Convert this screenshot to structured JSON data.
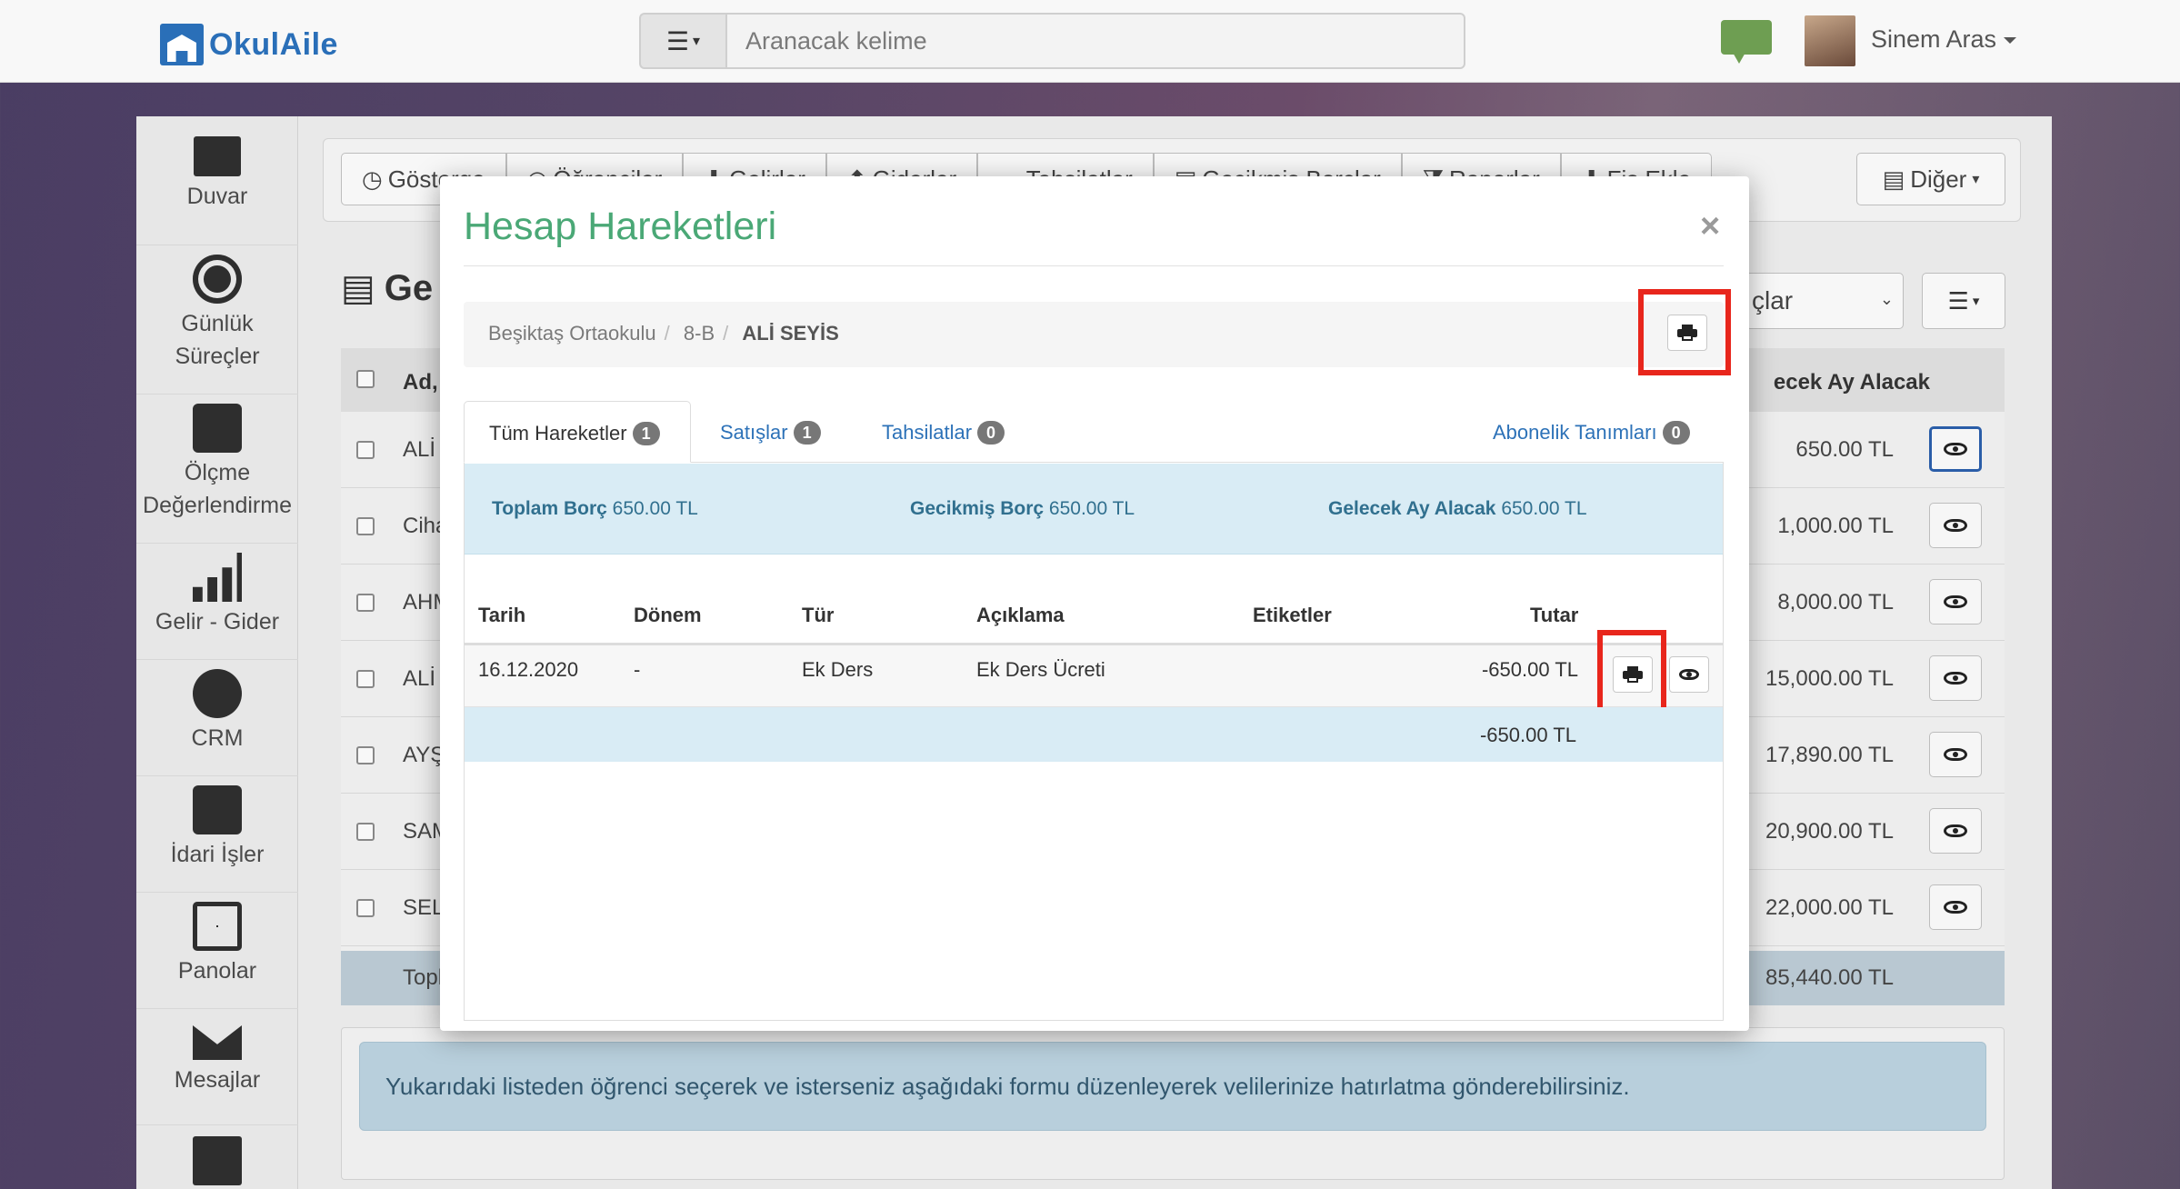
{
  "navbar": {
    "logo_text": "OkulAile",
    "search_placeholder": "Aranacak kelime",
    "user_name": "Sinem Aras"
  },
  "sidebar": {
    "items": [
      {
        "label": "Duvar",
        "icon": "layers-icon"
      },
      {
        "label": "Günlük Süreçler",
        "icon": "clock-icon"
      },
      {
        "label": "Ölçme Değerlendirme",
        "icon": "pulse-monitor-icon"
      },
      {
        "label": "Gelir - Gider",
        "icon": "bar-chart-icon"
      },
      {
        "label": "CRM",
        "icon": "chat-bubbles-icon"
      },
      {
        "label": "İdari İşler",
        "icon": "briefcase-icon"
      },
      {
        "label": "Panolar",
        "icon": "calendar-icon"
      },
      {
        "label": "Mesajlar",
        "icon": "envelope-icon"
      },
      {
        "label": "",
        "icon": "family-icon"
      }
    ]
  },
  "toolbar": {
    "buttons": [
      "Gösterge",
      "Öğrenciler",
      "Gelirler",
      "Giderler",
      "Tahsilatlar",
      "Gecikmiş Borçlar",
      "Raporlar",
      "Fiş Ekle"
    ],
    "more_label": "Diğer"
  },
  "background_panel": {
    "title": "Ge",
    "filter_value": "çlar",
    "header_name": "Ad,",
    "header_amount": "ecek Ay Alacak",
    "rows": [
      {
        "name": "ALİ",
        "amount": "650.00 TL"
      },
      {
        "name": "Ciha",
        "amount": "1,000.00 TL"
      },
      {
        "name": "AHM",
        "amount": "8,000.00 TL"
      },
      {
        "name": "ALİ",
        "amount": "15,000.00 TL"
      },
      {
        "name": "AYŞ",
        "amount": "17,890.00 TL"
      },
      {
        "name": "SAM",
        "amount": "20,900.00 TL"
      },
      {
        "name": "SEL",
        "amount": "22,000.00 TL"
      }
    ],
    "total_label": "Topl",
    "total_amount": "85,440.00 TL",
    "info_text": "Yukarıdaki listeden öğrenci seçerek ve isterseniz aşağıdaki formu düzenleyerek velilerinize hatırlatma gönderebilirsiniz."
  },
  "modal": {
    "title": "Hesap Hareketleri",
    "close_label": "×",
    "breadcrumb": [
      "Beşiktaş Ortaokulu",
      "8-B",
      "ALİ SEYİS"
    ],
    "tabs": [
      {
        "label": "Tüm Hareketler",
        "count": "1"
      },
      {
        "label": "Satışlar",
        "count": "1"
      },
      {
        "label": "Tahsilatlar",
        "count": "0"
      },
      {
        "label": "Abonelik Tanımları",
        "count": "0"
      }
    ],
    "summary": [
      {
        "label": "Toplam Borç",
        "value": "650.00 TL"
      },
      {
        "label": "Gecikmiş Borç",
        "value": "650.00 TL"
      },
      {
        "label": "Gelecek Ay Alacak",
        "value": "650.00 TL"
      }
    ],
    "columns": [
      "Tarih",
      "Dönem",
      "Tür",
      "Açıklama",
      "Etiketler",
      "Tutar"
    ],
    "rows": [
      {
        "tarih": "16.12.2020",
        "donem": "-",
        "tur": "Ek Ders",
        "aciklama": "Ek Ders Ücreti",
        "etiketler": "",
        "tutar": "-650.00 TL"
      }
    ],
    "total": "-650.00 TL"
  },
  "colors": {
    "modal_title": "#4aa876",
    "link": "#2d72b8",
    "summary_bg": "#d9ecf5",
    "highlight": "#e8261c"
  }
}
